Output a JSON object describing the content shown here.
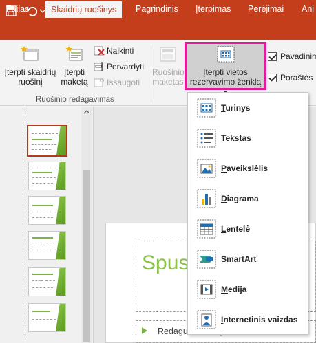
{
  "titlebar": {
    "qat_icons": [
      "save-icon",
      "undo-icon",
      "undo-dropdown-icon",
      "redo-icon",
      "touch-mode-icon",
      "touch-mode-dropdown-icon",
      "customize-qat-icon"
    ]
  },
  "tabs": [
    {
      "label": "Failas"
    },
    {
      "label": "Skaidrių ruošinys"
    },
    {
      "label": "Pagrindinis"
    },
    {
      "label": "Įterpimas"
    },
    {
      "label": "Perėjimai"
    },
    {
      "label": "Ani"
    }
  ],
  "ribbon": {
    "insert_master_line1": "Įterpti skaidrių",
    "insert_master_line2": "ruošinį",
    "insert_layout_line1": "Įterpti",
    "insert_layout_line2": "maketą",
    "delete": "Naikinti",
    "rename": "Pervardyti",
    "preserve": "Išsaugoti",
    "group_label": "Ruošinio redagavimas",
    "master_layout_line1": "Ruošinio",
    "master_layout_line2": "maketas",
    "insert_placeholder_line1": "Įterpti vietos",
    "insert_placeholder_line2": "rezervavimo ženklą",
    "title_checkbox": "Pavadinim",
    "footers_checkbox": "Poraštės"
  },
  "dropdown": {
    "items": [
      {
        "label": "Turinys",
        "icon": "content-placeholder-icon"
      },
      {
        "label": "Tekstas",
        "icon": "text-placeholder-icon"
      },
      {
        "label": "Paveikslėlis",
        "icon": "picture-placeholder-icon"
      },
      {
        "label": "Diagrama",
        "icon": "chart-placeholder-icon"
      },
      {
        "label": "Lentelė",
        "icon": "table-placeholder-icon"
      },
      {
        "label": "SmartArt",
        "icon": "smartart-placeholder-icon"
      },
      {
        "label": "Medija",
        "icon": "media-placeholder-icon"
      },
      {
        "label": "Internetinis vaizdas",
        "icon": "online-image-placeholder-icon"
      }
    ]
  },
  "slide": {
    "title_text": "Spust",
    "body_text": "Redaguoti tekstų stilius"
  },
  "colors": {
    "accent": "#c43e1c",
    "highlight": "#e8189a",
    "theme_green": "#8bc34a"
  }
}
